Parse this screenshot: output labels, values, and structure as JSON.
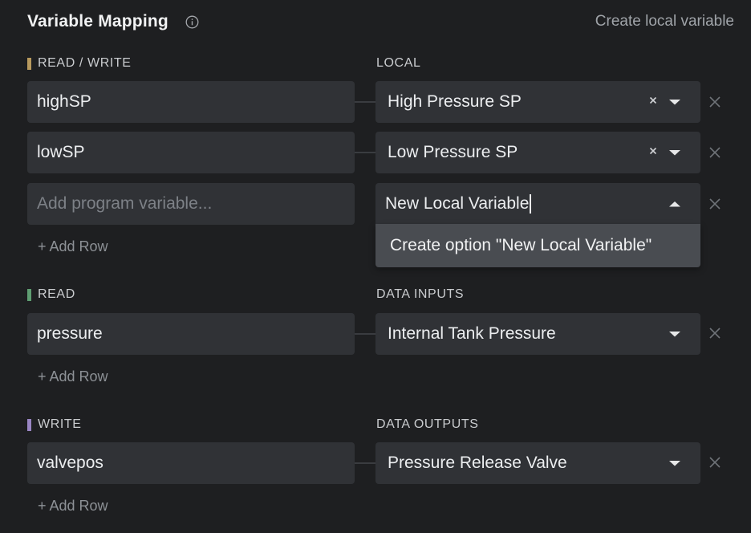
{
  "header": {
    "title": "Variable Mapping",
    "create_link": "Create local variable"
  },
  "colors": {
    "read_write": "#b89a5e",
    "read": "#5f9e72",
    "write": "#9a86c4"
  },
  "read_write": {
    "label": "READ / WRITE",
    "column_label": "LOCAL",
    "rows": [
      {
        "program_var": "highSP",
        "mapped": "High Pressure SP"
      },
      {
        "program_var": "lowSP",
        "mapped": "Low Pressure SP"
      }
    ],
    "new_row": {
      "placeholder": "Add program variable...",
      "input_value": "New Local Variable",
      "create_option": "Create option \"New Local Variable\""
    },
    "add_row": "+ Add Row"
  },
  "read": {
    "label": "READ",
    "column_label": "DATA INPUTS",
    "rows": [
      {
        "program_var": "pressure",
        "mapped": "Internal Tank Pressure"
      }
    ],
    "add_row": "+ Add Row"
  },
  "write": {
    "label": "WRITE",
    "column_label": "DATA OUTPUTS",
    "rows": [
      {
        "program_var": "valvepos",
        "mapped": "Pressure Release Valve"
      }
    ],
    "add_row": "+ Add Row"
  }
}
